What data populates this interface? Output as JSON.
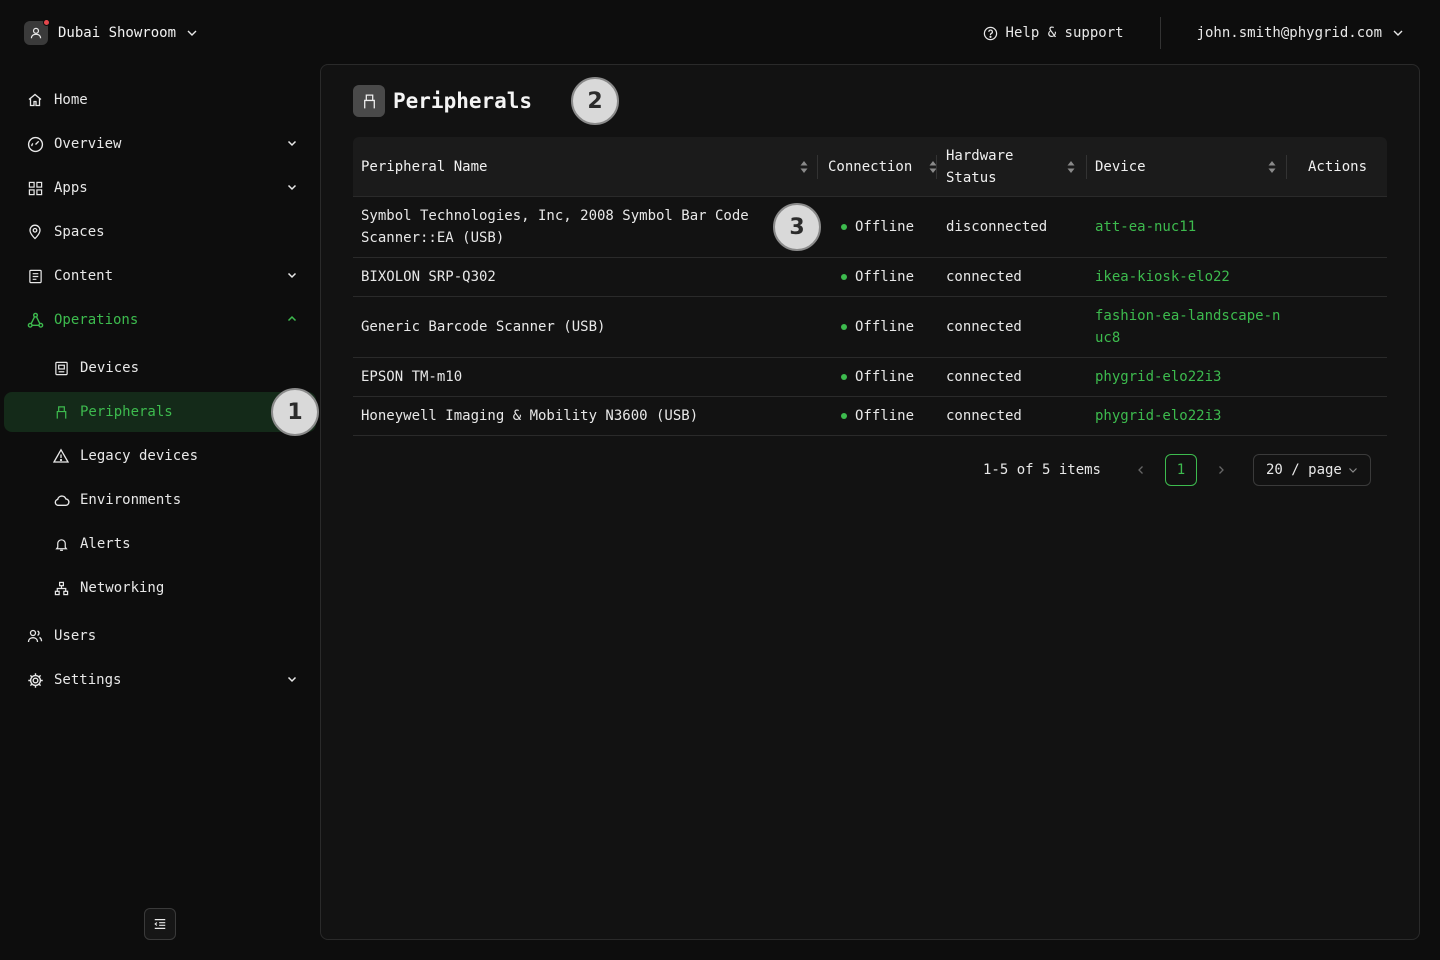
{
  "workspace": {
    "name": "Dubai Showroom"
  },
  "header": {
    "help_label": "Help & support",
    "account_email": "john.smith@phygrid.com"
  },
  "sidebar": {
    "items": [
      {
        "label": "Home"
      },
      {
        "label": "Overview"
      },
      {
        "label": "Apps"
      },
      {
        "label": "Spaces"
      },
      {
        "label": "Content"
      },
      {
        "label": "Operations"
      },
      {
        "label": "Devices"
      },
      {
        "label": "Peripherals"
      },
      {
        "label": "Legacy devices"
      },
      {
        "label": "Environments"
      },
      {
        "label": "Alerts"
      },
      {
        "label": "Networking"
      },
      {
        "label": "Users"
      },
      {
        "label": "Settings"
      }
    ]
  },
  "page": {
    "title": "Peripherals"
  },
  "table": {
    "columns": [
      "Peripheral Name",
      "Connection",
      "Hardware Status",
      "Device",
      "Actions"
    ],
    "rows": [
      {
        "name": "Symbol Technologies, Inc, 2008 Symbol Bar Code Scanner::EA (USB)",
        "connection": "Offline",
        "hardware": "disconnected",
        "device": "att-ea-nuc11"
      },
      {
        "name": "BIXOLON SRP-Q302",
        "connection": "Offline",
        "hardware": "connected",
        "device": "ikea-kiosk-elo22"
      },
      {
        "name": "Generic Barcode Scanner (USB)",
        "connection": "Offline",
        "hardware": "connected",
        "device": "fashion-ea-landscape-nuc8"
      },
      {
        "name": "EPSON TM-m10",
        "connection": "Offline",
        "hardware": "connected",
        "device": "phygrid-elo22i3"
      },
      {
        "name": "Honeywell Imaging & Mobility N3600 (USB)",
        "connection": "Offline",
        "hardware": "connected",
        "device": "phygrid-elo22i3"
      }
    ]
  },
  "pagination": {
    "total_text": "1-5 of 5 items",
    "current_page": "1",
    "page_size": "20 / page"
  },
  "markers": [
    "1",
    "2",
    "3"
  ],
  "colors": {
    "accent": "#3dbb4e",
    "background": "#0d0d0d",
    "panel": "#121212",
    "selected_bg": "#142a19"
  }
}
